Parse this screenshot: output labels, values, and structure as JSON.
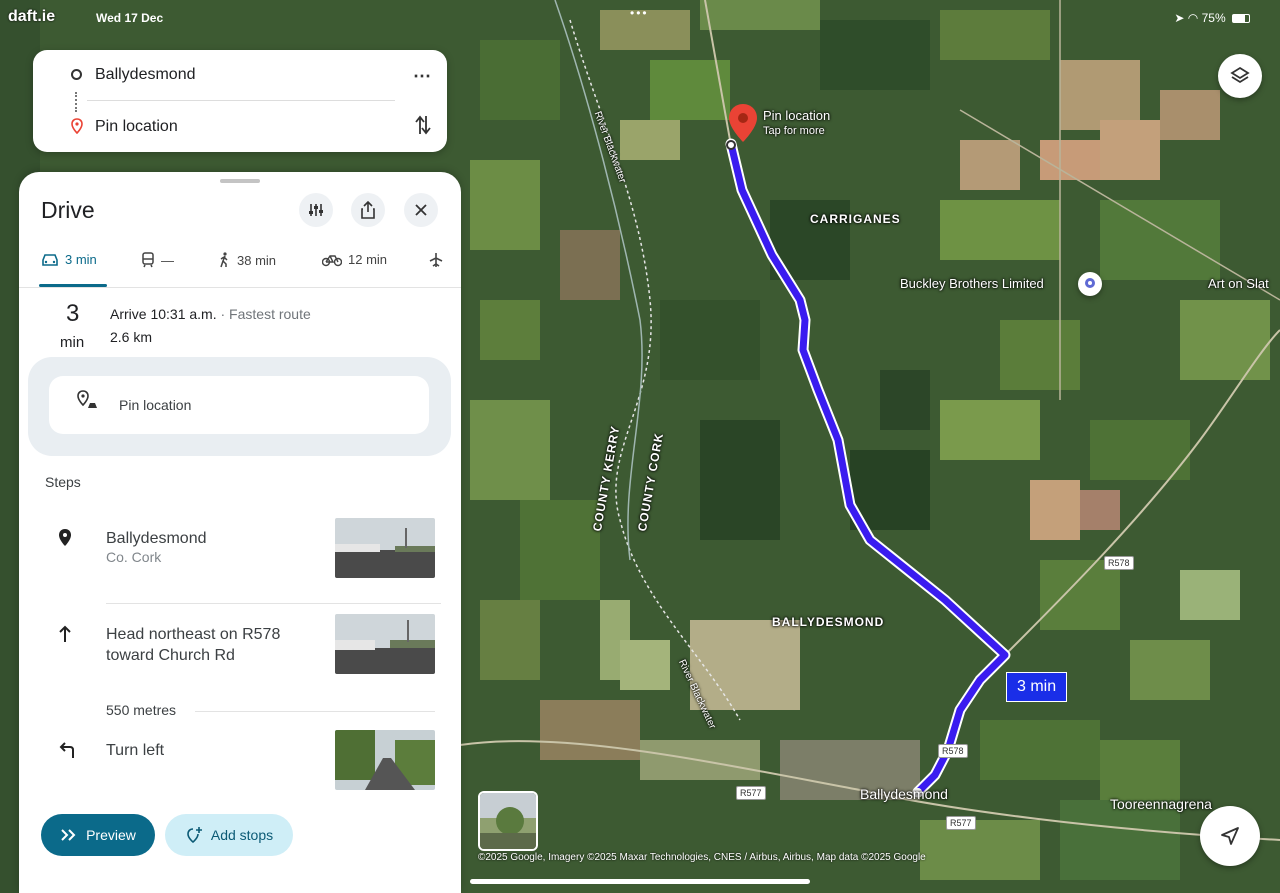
{
  "status_bar": {
    "brand": "daft.ie",
    "date": "Wed 17 Dec",
    "dots": "•••",
    "battery": "75%"
  },
  "search": {
    "origin": "Ballydesmond",
    "destination": "Pin location"
  },
  "panel": {
    "title": "Drive",
    "tabs": [
      {
        "label": "3 min",
        "icon": "car-icon",
        "active": true
      },
      {
        "label": "—",
        "icon": "transit-icon",
        "active": false
      },
      {
        "label": "38 min",
        "icon": "walk-icon",
        "active": false
      },
      {
        "label": "12 min",
        "icon": "bike-icon",
        "active": false
      },
      {
        "label": "",
        "icon": "flight-icon",
        "active": false
      }
    ],
    "summary": {
      "minutes": "3",
      "unit": "min",
      "arrive": "Arrive 10:31 a.m.",
      "route_type": " · Fastest route",
      "distance": "2.6 km"
    },
    "destination_label": "Pin location",
    "steps_title": "Steps",
    "steps": [
      {
        "title": "Ballydesmond",
        "subtitle": "Co. Cork",
        "icon": "location-pin-icon"
      },
      {
        "title": "Head northeast on R578 toward Church Rd",
        "subtitle": "",
        "icon": "arrow-up-icon"
      },
      {
        "title": "Turn left",
        "subtitle": "",
        "icon": "turn-left-icon"
      }
    ],
    "step_distance": "550 metres",
    "preview_label": "Preview",
    "add_stops_label": "Add stops"
  },
  "map": {
    "pin_title": "Pin location",
    "pin_subtitle": "Tap for more",
    "labels": {
      "carriganes": "CARRIGANES",
      "ballydesmond_upper": "BALLYDESMOND",
      "county_kerry": "COUNTY KERRY",
      "county_cork": "COUNTY CORK",
      "buckley": "Buckley Brothers Limited",
      "art_on_slate": "Art on Slat",
      "ballydesmond_town": "Ballydesmond",
      "tooreenna": "Tooreennagrena",
      "river1": "River Blackwater",
      "river2": "River Blackwater"
    },
    "road_shields": [
      "R578",
      "R578",
      "R577",
      "R577"
    ],
    "duration_badge": "3 min",
    "attribution": "©2025 Google, Imagery ©2025 Maxar Technologies, CNES / Airbus, Airbus, Map data ©2025 Google",
    "route_color": "#3a1cf0"
  }
}
